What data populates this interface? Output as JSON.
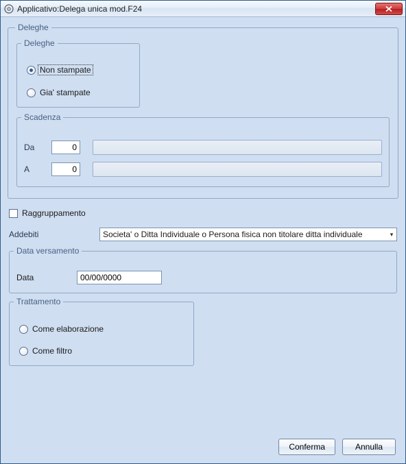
{
  "window": {
    "title": "Applicativo:Delega unica mod.F24"
  },
  "deleghe_outer": {
    "legend": "Deleghe"
  },
  "deleghe_inner": {
    "legend": "Deleghe",
    "opt_non_stampate": "Non stampate",
    "opt_gia_stampate": "Gia' stampate"
  },
  "scadenza": {
    "legend": "Scadenza",
    "da_label": "Da",
    "da_value": "0",
    "a_label": "A",
    "a_value": "0"
  },
  "raggruppamento": {
    "label": "Raggruppamento"
  },
  "addebiti": {
    "label": "Addebiti",
    "selected": "Societa' o Ditta Individuale o Persona fisica non titolare ditta individuale"
  },
  "data_versamento": {
    "legend": "Data versamento",
    "label": "Data",
    "value": "00/00/0000"
  },
  "trattamento": {
    "legend": "Trattamento",
    "opt_elab": "Come elaborazione",
    "opt_filtro": "Come filtro"
  },
  "buttons": {
    "conferma": "Conferma",
    "annulla": "Annulla"
  }
}
